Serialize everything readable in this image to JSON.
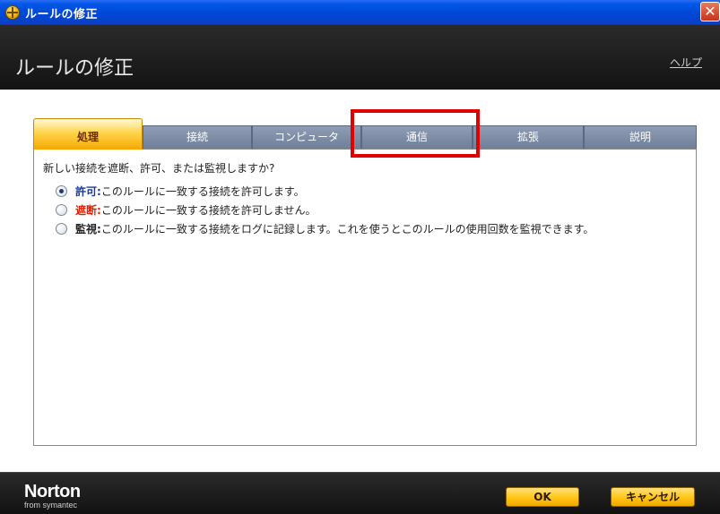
{
  "window": {
    "title": "ルールの修正",
    "icon": "norton-globe-icon"
  },
  "header": {
    "title": "ルールの修正",
    "help_label": "ヘルプ"
  },
  "tabs": [
    {
      "label": "処理",
      "active": true
    },
    {
      "label": "接続",
      "active": false
    },
    {
      "label": "コンピュータ",
      "active": false
    },
    {
      "label": "通信",
      "active": false
    },
    {
      "label": "拡張",
      "active": false
    },
    {
      "label": "説明",
      "active": false
    }
  ],
  "panel": {
    "question": "新しい接続を遮断、許可、または監視しますか?",
    "options": [
      {
        "keyword": "許可:",
        "text": "このルールに一致する接続を許可します。",
        "checked": true,
        "keyword_color": "#1a3a9a"
      },
      {
        "keyword": "遮断:",
        "text": "このルールに一致する接続を許可しません。",
        "checked": false,
        "keyword_color": "#e02000"
      },
      {
        "keyword": "監視:",
        "text": "このルールに一致する接続をログに記録します。これを使うとこのルールの使用回数を監視できます。",
        "checked": false,
        "keyword_color": "#222222"
      }
    ]
  },
  "footer": {
    "logo": "Norton",
    "logo_sub": "from symantec",
    "ok_label": "OK",
    "cancel_label": "キャンセル"
  },
  "colors": {
    "highlight": "#e00000",
    "accent": "#ffc414"
  }
}
